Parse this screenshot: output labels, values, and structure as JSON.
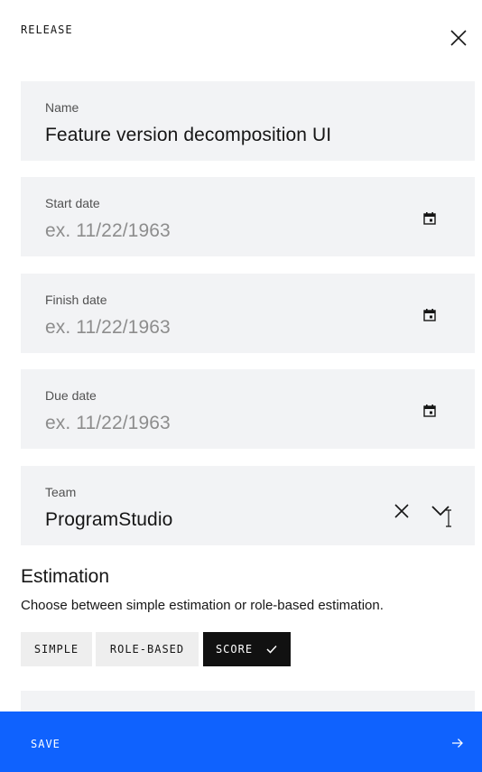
{
  "header": {
    "title": "RELEASE"
  },
  "fields": {
    "name": {
      "label": "Name",
      "value": "Feature version decomposition UI"
    },
    "start_date": {
      "label": "Start date",
      "placeholder": "ex. 11/22/1963"
    },
    "finish_date": {
      "label": "Finish date",
      "placeholder": "ex. 11/22/1963"
    },
    "due_date": {
      "label": "Due date",
      "placeholder": "ex. 11/22/1963"
    },
    "team": {
      "label": "Team",
      "value": "ProgramStudio"
    }
  },
  "estimation": {
    "title": "Estimation",
    "description": "Choose between simple estimation or role-based estimation.",
    "options": [
      {
        "label": "SIMPLE",
        "selected": false
      },
      {
        "label": "ROLE-BASED",
        "selected": false
      },
      {
        "label": "SCORE",
        "selected": true
      }
    ]
  },
  "footer": {
    "save_label": "SAVE"
  },
  "colors": {
    "accent": "#0f62fe",
    "field_bg": "#f2f3f5",
    "selected_chip": "#111111"
  },
  "icons": [
    "close-icon",
    "calendar-icon",
    "clear-icon",
    "chevron-down-icon",
    "text-cursor-icon",
    "checkmark-icon",
    "arrow-right-icon"
  ]
}
